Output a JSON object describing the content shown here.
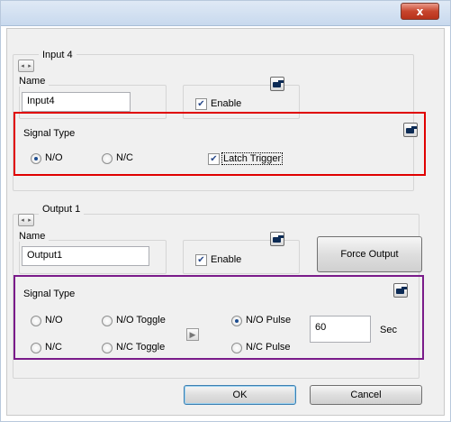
{
  "titlebar": {
    "close_glyph": "x"
  },
  "input_section": {
    "group_title": "Input 4",
    "name_label": "Name",
    "name_value": "Input4",
    "enable_label": "Enable",
    "enable_checked": true,
    "signal_type_label": "Signal Type",
    "radios": [
      {
        "label": "N/O",
        "checked": true
      },
      {
        "label": "N/C",
        "checked": false
      }
    ],
    "latch_label": "Latch Trigger",
    "latch_checked": true
  },
  "output_section": {
    "group_title": "Output 1",
    "name_label": "Name",
    "name_value": "Output1",
    "enable_label": "Enable",
    "enable_checked": true,
    "force_output_label": "Force Output",
    "signal_type_label": "Signal Type",
    "radios": [
      {
        "label": "N/O",
        "checked": false
      },
      {
        "label": "N/C",
        "checked": false
      },
      {
        "label": "N/O Toggle",
        "checked": false
      },
      {
        "label": "N/C Toggle",
        "checked": false
      },
      {
        "label": "N/O Pulse",
        "checked": true
      },
      {
        "label": "N/C Pulse",
        "checked": false
      }
    ],
    "pulse_value": "60",
    "pulse_unit": "Sec"
  },
  "footer": {
    "ok_label": "OK",
    "cancel_label": "Cancel"
  },
  "colors": {
    "input_highlight": "#e00000",
    "output_highlight": "#7a1b8a"
  },
  "icons": [
    "close-icon",
    "nav-arrows-icon",
    "hand-pointer-icon",
    "play-icon"
  ]
}
